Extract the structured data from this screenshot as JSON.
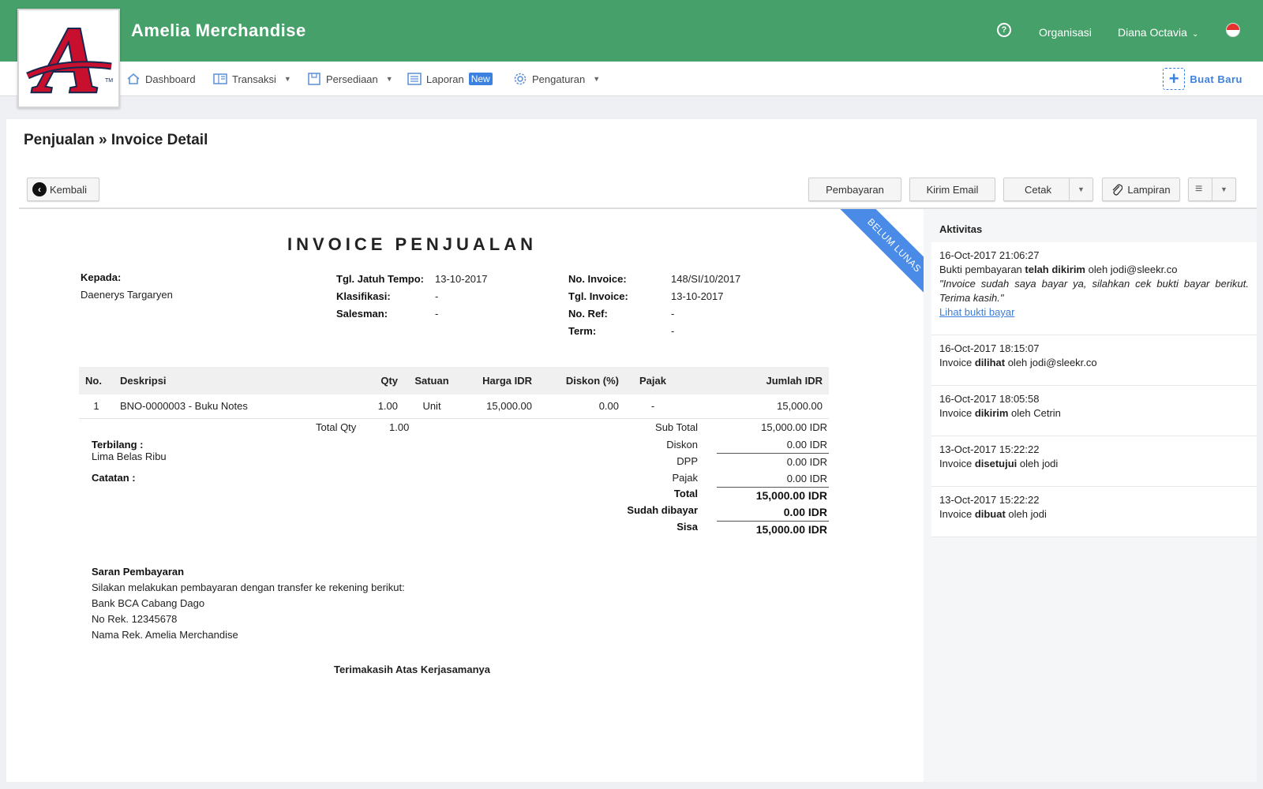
{
  "header": {
    "app_title": "Amelia Merchandise",
    "help_label": "?",
    "organization": "Organisasi",
    "user": "Diana Octavia",
    "user_caret": "⌄",
    "logo_letter": "A",
    "logo_tm": "TM"
  },
  "nav": {
    "items": [
      {
        "label": "Dashboard",
        "icon": "home-icon"
      },
      {
        "label": "Transaksi",
        "icon": "transactions-icon"
      },
      {
        "label": "Persediaan",
        "icon": "inventory-icon"
      },
      {
        "label": "Laporan",
        "icon": "report-icon",
        "badge": "New"
      },
      {
        "label": "Pengaturan",
        "icon": "gear-icon"
      }
    ],
    "caret": "▼",
    "create_new": "Buat Baru",
    "create_new_plus": "+"
  },
  "page": {
    "breadcrumb": "Penjualan » Invoice Detail"
  },
  "toolbar": {
    "back": "Kembali",
    "back_glyph": "‹",
    "payment": "Pembayaran",
    "send_email": "Kirim Email",
    "print": "Cetak",
    "attachment": "Lampiran",
    "attachment_glyph": "⌇",
    "menu_glyph": "≡",
    "caret": "▼"
  },
  "invoice": {
    "status_ribbon": "BELUM LUNAS",
    "title": "INVOICE PENJUALAN",
    "to_label": "Kepada:",
    "to_value": "Daenerys Targaryen",
    "due_date_label": "Tgl. Jatuh Tempo:",
    "due_date": "13-10-2017",
    "classification_label": "Klasifikasi:",
    "classification": "-",
    "salesman_label": "Salesman:",
    "salesman": "-",
    "invoice_no_label": "No. Invoice:",
    "invoice_no": "148/SI/10/2017",
    "invoice_date_label": "Tgl. Invoice:",
    "invoice_date": "13-10-2017",
    "ref_label": "No. Ref:",
    "ref": "-",
    "term_label": "Term:",
    "term": "-",
    "columns": [
      "No.",
      "Deskripsi",
      "Qty",
      "Satuan",
      "Harga IDR",
      "Diskon (%)",
      "Pajak",
      "Jumlah IDR"
    ],
    "rows": [
      [
        "1",
        "BNO-0000003 - Buku Notes",
        "1.00",
        "Unit",
        "15,000.00",
        "0.00",
        "-",
        "15,000.00"
      ]
    ],
    "total_qty_label": "Total Qty",
    "total_qty": "1.00",
    "spelled_label": "Terbilang :",
    "spelled_value": "Lima Belas Ribu",
    "notes_label": "Catatan :",
    "summary": {
      "subtotal_label": "Sub Total",
      "subtotal": "15,000.00 IDR",
      "discount_label": "Diskon",
      "discount": "0.00 IDR",
      "dpp_label": "DPP",
      "dpp": "0.00 IDR",
      "tax_label": "Pajak",
      "tax": "0.00 IDR",
      "total_label": "Total",
      "total": "15,000.00 IDR",
      "paid_label": "Sudah dibayar",
      "paid": "0.00 IDR",
      "remaining_label": "Sisa",
      "remaining": "15,000.00 IDR"
    },
    "payment_advice": {
      "title": "Saran Pembayaran",
      "line1": "Silakan melakukan pembayaran dengan transfer ke rekening berikut:",
      "line2": "Bank BCA Cabang Dago",
      "line3": "No Rek. 12345678",
      "line4": "Nama Rek. Amelia Merchandise"
    },
    "thanks": "Terimakasih Atas Kerjasamanya"
  },
  "activity": {
    "title": "Aktivitas",
    "items": [
      {
        "time": "16-Oct-2017 21:06:27",
        "pre": "Bukti pembayaran ",
        "bold": "telah dikirim",
        "post": " oleh jodi@sleekr.co",
        "quote": "\"Invoice sudah saya bayar ya, silahkan cek bukti bayar berikut. Terima kasih.\"",
        "link": "Lihat bukti bayar"
      },
      {
        "time": "16-Oct-2017 18:15:07",
        "pre": "Invoice ",
        "bold": "dilihat",
        "post": " oleh jodi@sleekr.co"
      },
      {
        "time": "16-Oct-2017 18:05:58",
        "pre": "Invoice ",
        "bold": "dikirim",
        "post": " oleh Cetrin"
      },
      {
        "time": "13-Oct-2017 15:22:22",
        "pre": "Invoice ",
        "bold": "disetujui",
        "post": " oleh jodi"
      },
      {
        "time": "13-Oct-2017 15:22:22",
        "pre": "Invoice ",
        "bold": "dibuat",
        "post": " oleh jodi"
      }
    ]
  },
  "colors": {
    "header_green": "#46a069",
    "accent_blue": "#3b82e0",
    "ribbon_blue": "#4a8be8",
    "logo_red": "#c8102e",
    "logo_navy": "#13274f"
  }
}
